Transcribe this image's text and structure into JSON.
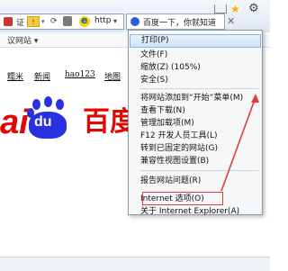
{
  "browser": {
    "address_zh": "证",
    "address_url": "http",
    "tab_title": "百度一下，你就知道",
    "fav_label": "议网站 ▾"
  },
  "page": {
    "nav": [
      "糯米",
      "新闻",
      "hao123",
      "地图"
    ],
    "logo_latin": "ai",
    "logo_du": "du",
    "logo_cn": "百度"
  },
  "menu": {
    "items": [
      "打印(P)",
      "文件(F)",
      "缩放(Z) (105%)",
      "安全(S)",
      "将网站添加到“开始”菜单(M)",
      "查看下载(N)",
      "管理加载项(M)",
      "F12 开发人员工具(L)",
      "转到已固定的网站(G)",
      "兼容性视图设置(B)",
      "报告网站问题(R)",
      "Internet 选项(O)",
      "关于 Internet Explorer(A)"
    ]
  },
  "colors": {
    "baidu_red": "#e10602",
    "baidu_blue": "#2932e1",
    "annotation_red": "#e03c3c"
  }
}
